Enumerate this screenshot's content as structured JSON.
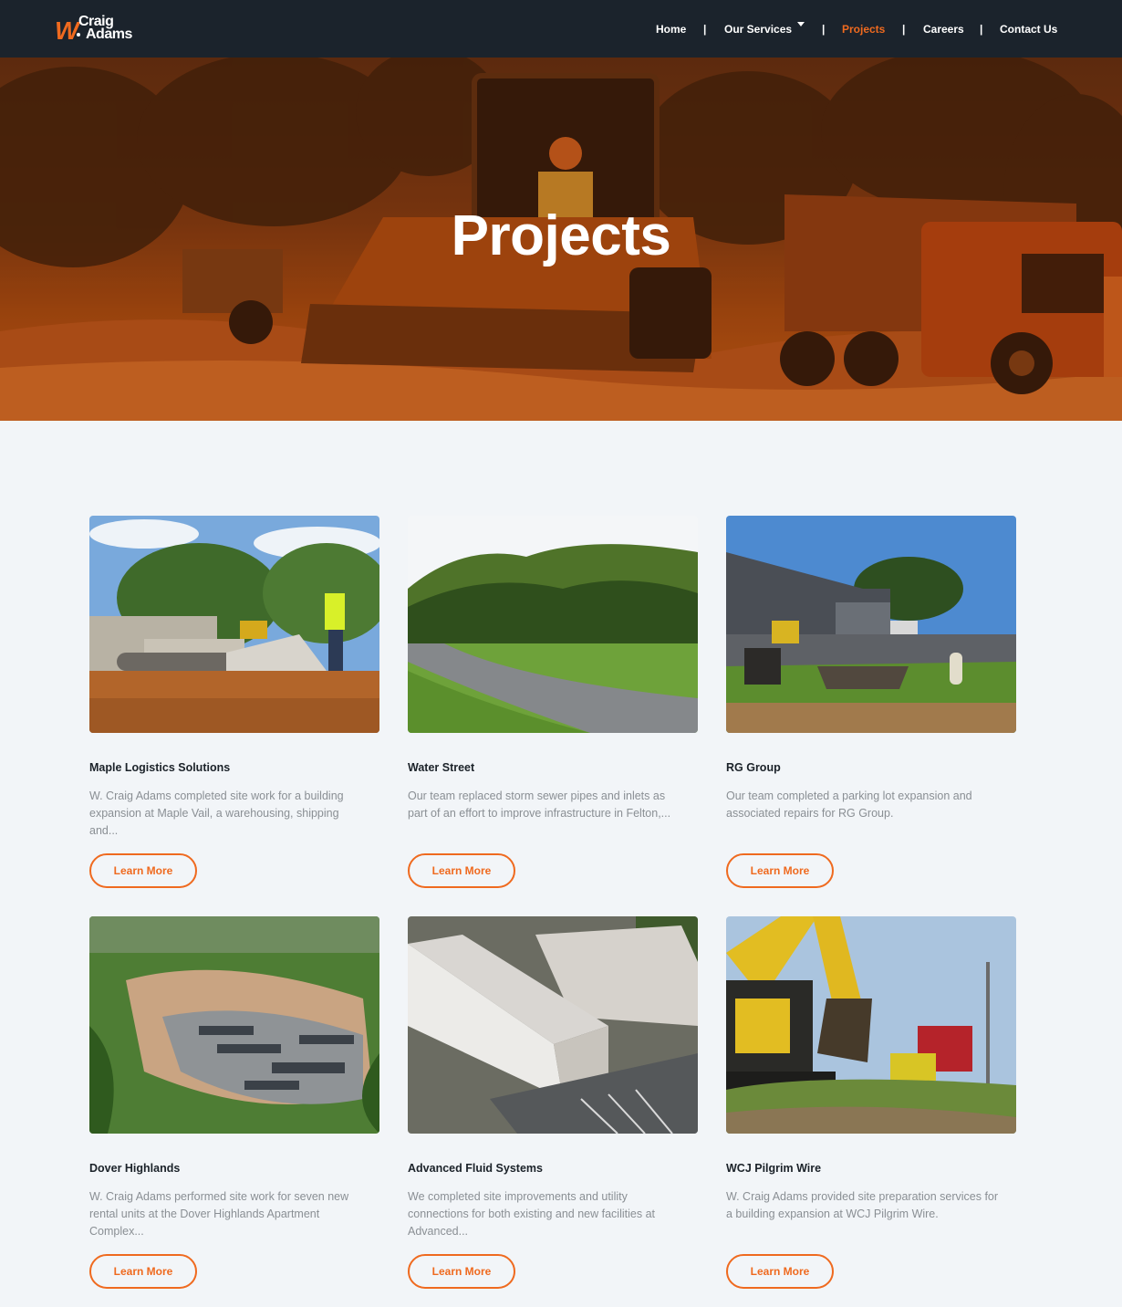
{
  "header": {
    "logo": {
      "mark": "W",
      "line1": "Craig",
      "line2": "Adams"
    },
    "nav": [
      {
        "label": "Home"
      },
      {
        "label": "Our Services"
      },
      {
        "label": "Projects"
      },
      {
        "label": "Careers"
      },
      {
        "label": "Contact Us"
      }
    ],
    "separator": "|",
    "icons": {
      "dropdown": "caret-down-icon"
    }
  },
  "hero": {
    "title": "Projects"
  },
  "projects": [
    {
      "title": "Maple Logistics Solutions",
      "description": "W. Craig Adams completed site work for a building expansion at Maple Vail, a warehousing, shipping and...",
      "button": "Learn More"
    },
    {
      "title": "Water Street",
      "description": "Our team replaced storm sewer pipes and inlets as part of an effort to improve infrastructure in Felton,...",
      "button": "Learn More"
    },
    {
      "title": "RG Group",
      "description": "Our team completed a parking lot expansion and associated repairs for RG Group.",
      "button": "Learn More"
    },
    {
      "title": "Dover Highlands",
      "description": "W. Craig Adams performed site work for seven new rental units at the Dover Highlands Apartment Complex...",
      "button": "Learn More"
    },
    {
      "title": "Advanced Fluid Systems",
      "description": "We completed site improvements and utility connections for both existing and new facilities at Advanced...",
      "button": "Learn More"
    },
    {
      "title": "WCJ Pilgrim Wire",
      "description": "W. Craig Adams provided site preparation services for a building expansion at WCJ Pilgrim Wire.",
      "button": "Learn More"
    }
  ],
  "colors": {
    "accent": "#ef6a1f",
    "header_bg": "#1b232c",
    "page_bg": "#f2f5f8",
    "text_muted": "#8a8f94"
  }
}
